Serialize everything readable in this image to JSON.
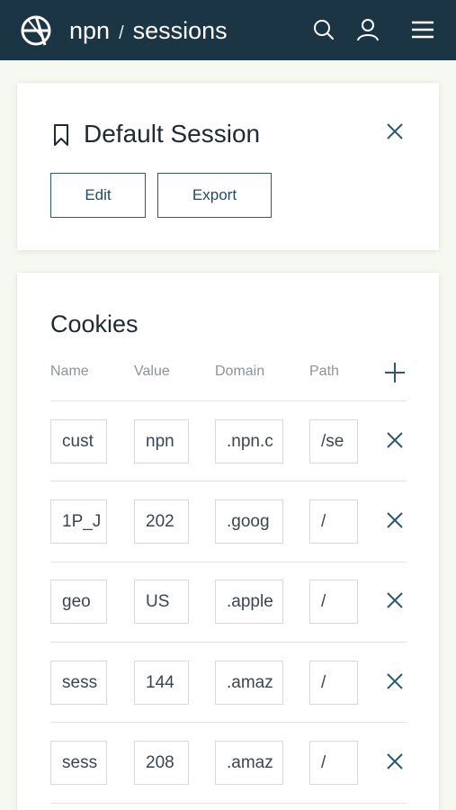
{
  "header": {
    "brand": "npn",
    "separator": "/",
    "section": "sessions",
    "icons": [
      "logo-icon",
      "search-icon",
      "user-icon",
      "menu-icon"
    ]
  },
  "session": {
    "title": "Default Session",
    "edit_label": "Edit",
    "export_label": "Export"
  },
  "cookies": {
    "title": "Cookies",
    "columns": [
      "Name",
      "Value",
      "Domain",
      "Path"
    ],
    "rows": [
      {
        "name": "cust",
        "value": "npn",
        "domain": ".npn.c",
        "path": "/se"
      },
      {
        "name": "1P_J",
        "value": "202",
        "domain": ".goog",
        "path": "/"
      },
      {
        "name": "geo",
        "value": "US",
        "domain": ".apple",
        "path": "/"
      },
      {
        "name": "sess",
        "value": "144",
        "domain": ".amaz",
        "path": "/"
      },
      {
        "name": "sess",
        "value": "208",
        "domain": ".amaz",
        "path": "/"
      }
    ]
  },
  "colors": {
    "header_bg": "#1c3545",
    "accent": "#2b5a72",
    "page_bg": "#f6f9f1"
  }
}
